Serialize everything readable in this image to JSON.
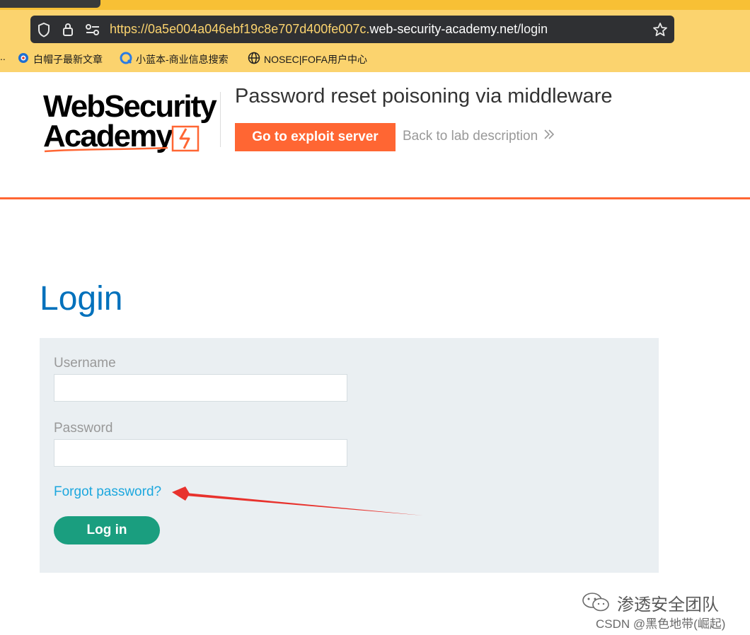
{
  "browser": {
    "url": {
      "protocol": "https://",
      "host_sub": "0a5e004a046ebf19c8e707d400fe007c.",
      "host_domain": "web-security-academy.net",
      "path": "/login"
    },
    "bookmarks": [
      {
        "label": "白帽子最新文章",
        "icon": "baimaozi-icon"
      },
      {
        "label": "小蓝本-商业信息搜索",
        "icon": "xiaolanben-icon"
      },
      {
        "label": "NOSEC|FOFA用户中心",
        "icon": "globe-icon"
      }
    ],
    "bookmarks_overflow": "..",
    "icons": [
      "shield-icon",
      "lock-icon",
      "permissions-icon",
      "star-icon"
    ]
  },
  "header": {
    "logo_line1": "WebSecurity",
    "logo_line2": "Academy",
    "lab_title": "Password reset poisoning via middleware",
    "exploit_button": "Go to exploit server",
    "back_link": "Back to lab description"
  },
  "login": {
    "heading": "Login",
    "username_label": "Username",
    "username_value": "",
    "password_label": "Password",
    "password_value": "",
    "forgot_link": "Forgot password?",
    "submit_label": "Log in"
  },
  "watermark": {
    "team": "渗透安全团队",
    "csdn": "CSDN @黑色地带(崛起)"
  },
  "colors": {
    "brand_orange": "#ff6633",
    "login_blue": "#0071bc",
    "link_blue": "#1ca7de",
    "login_green": "#1a9e7f",
    "panel_bg": "#eaeff2",
    "browser_yellow": "#fbd36e",
    "arrow_red": "#e8322d"
  }
}
